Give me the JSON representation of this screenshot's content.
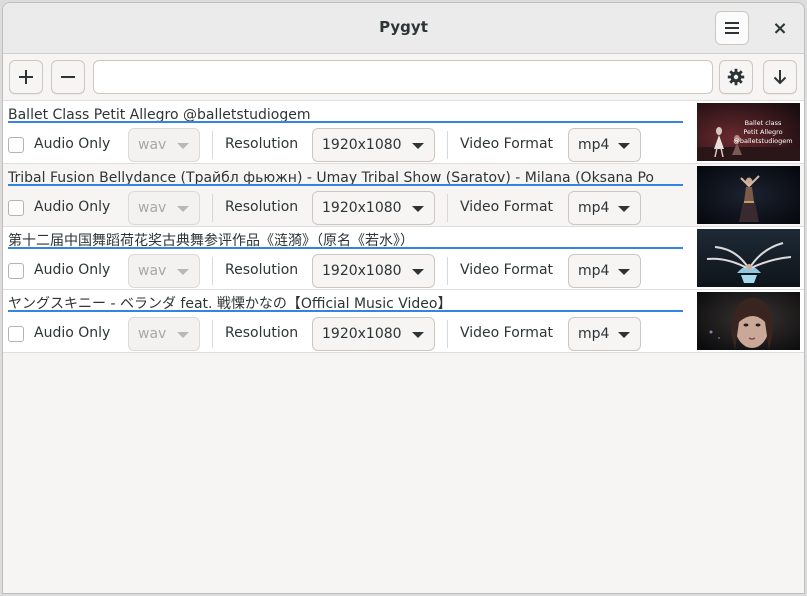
{
  "window": {
    "title": "Pygyt"
  },
  "header": {
    "menu_icon": "hamburger-menu-icon",
    "close_label": "×"
  },
  "toolbar": {
    "url_value": "",
    "url_placeholder": ""
  },
  "labels": {
    "audio_only": "Audio Only",
    "resolution": "Resolution",
    "video_format": "Video Format"
  },
  "items": [
    {
      "title": "Ballet Class Petit Allegro @balletstudiogem",
      "audio_only": false,
      "audio_format": "wav",
      "resolution": "1920x1080",
      "video_format": "mp4",
      "thumb_text": "Ballet class\nPetit Allegro\n@balletstudiogem"
    },
    {
      "title": "Tribal Fusion Bellydance (Трайбл фьюжн) - Umay Tribal Show (Saratov) - Milana (Oksana Po",
      "audio_only": false,
      "audio_format": "wav",
      "resolution": "1920x1080",
      "video_format": "mp4"
    },
    {
      "title": "第十二届中国舞蹈荷花奖古典舞参评作品《涟漪》（原名《若水》）",
      "audio_only": false,
      "audio_format": "wav",
      "resolution": "1920x1080",
      "video_format": "mp4"
    },
    {
      "title": "ヤングスキニー - ベランダ feat. 戦慄かなの【Official Music Video】",
      "audio_only": false,
      "audio_format": "wav",
      "resolution": "1920x1080",
      "video_format": "mp4"
    }
  ],
  "colors": {
    "accent": "#3584e4",
    "background": "#f6f5f4"
  }
}
